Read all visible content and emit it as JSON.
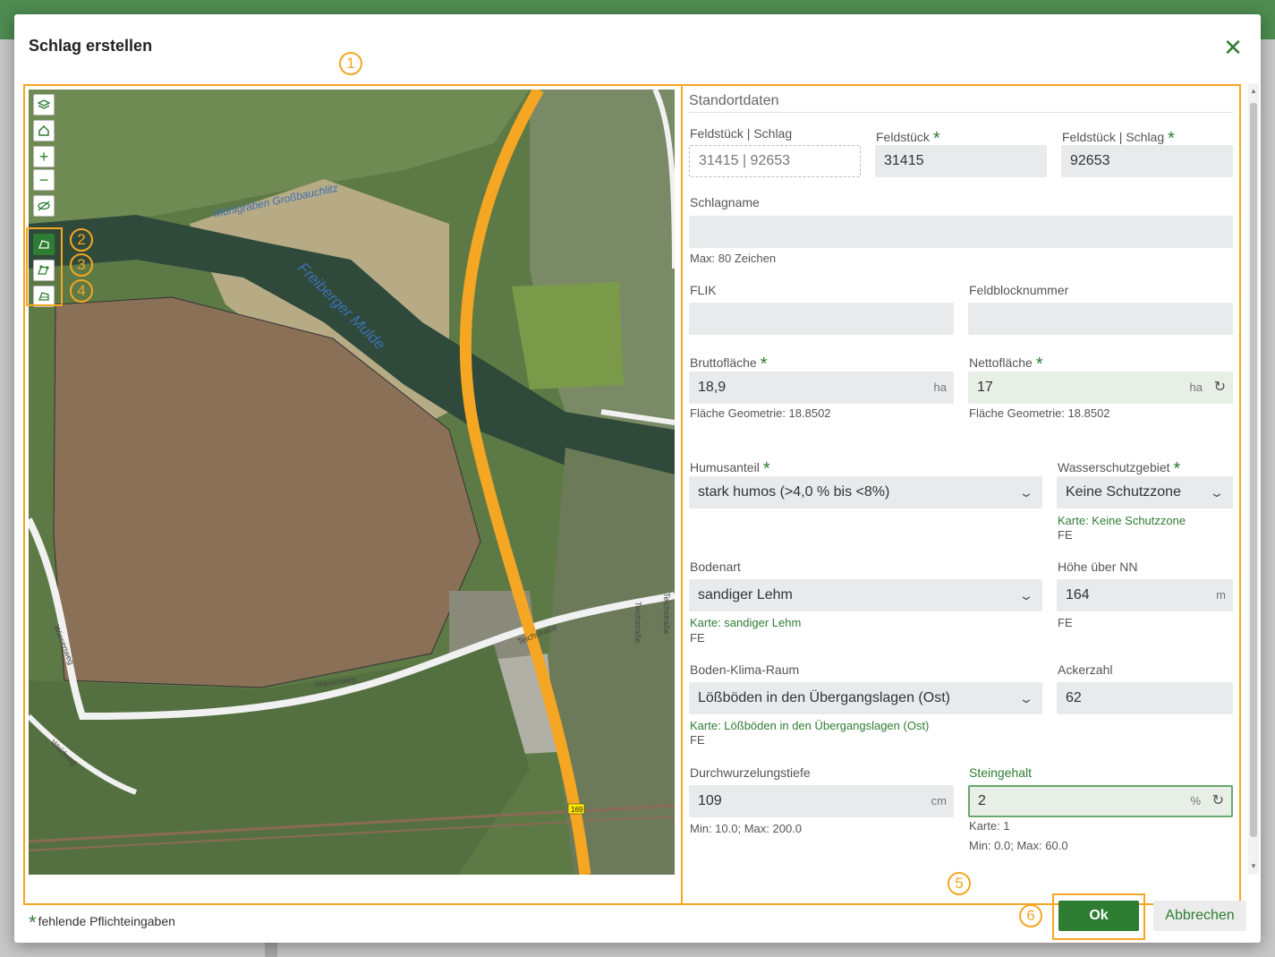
{
  "dialog": {
    "title": "Schlag erstellen",
    "close_icon": "close-icon"
  },
  "markers": [
    "1",
    "2",
    "3",
    "4",
    "5",
    "6"
  ],
  "map": {
    "labels": {
      "river": "Freiberger Mulde",
      "canal": "Mühlgraben Großbauchlitz",
      "road1": "Teichstraße",
      "road2": "Wiesenweg",
      "road3": "Wiesenweg",
      "road4": "Waldweg",
      "road5": "Teichstraße",
      "road6": "Teichstraße",
      "road_sign": "169"
    },
    "tools": [
      "layers-icon",
      "home-icon",
      "zoom-in-icon",
      "zoom-out-icon",
      "visibility-off-icon",
      "draw-polygon-icon",
      "edit-polygon-icon",
      "cut-polygon-icon"
    ],
    "tool_symbols": {
      "zoom_in": "+",
      "zoom_out": "−"
    }
  },
  "form": {
    "section_title": "Standortdaten",
    "feldstueck_schlag": {
      "label": "Feldstück | Schlag",
      "value": "31415 | 92653"
    },
    "feldstueck": {
      "label": "Feldstück",
      "value": "31415"
    },
    "feldstueck_schlag2": {
      "label": "Feldstück | Schlag",
      "value": "92653"
    },
    "schlagname": {
      "label": "Schlagname",
      "value": "",
      "hint": "Max: 80 Zeichen"
    },
    "flik": {
      "label": "FLIK",
      "value": ""
    },
    "feldblocknummer": {
      "label": "Feldblocknummer",
      "value": ""
    },
    "bruttoflaeche": {
      "label": "Bruttofläche",
      "value": "18,9",
      "unit": "ha",
      "hint": "Fläche Geometrie: 18.8502"
    },
    "nettoflaeche": {
      "label": "Nettofläche",
      "value": "17",
      "unit": "ha",
      "hint": "Fläche Geometrie: 18.8502"
    },
    "humusanteil": {
      "label": "Humusanteil",
      "value": "stark humos (>4,0 % bis <8%)"
    },
    "wasserschutzgebiet": {
      "label": "Wasserschutzgebiet",
      "value": "Keine Schutzzone",
      "hint_map": "Karte: Keine Schutzzone",
      "hint_src": "FE"
    },
    "bodenart": {
      "label": "Bodenart",
      "value": "sandiger Lehm",
      "hint_map": "Karte: sandiger Lehm",
      "hint_src": "FE"
    },
    "hoehe": {
      "label": "Höhe über NN",
      "value": "164",
      "unit": "m",
      "hint_src": "FE"
    },
    "boden_klima_raum": {
      "label": "Boden-Klima-Raum",
      "value": "Lößböden in den Übergangslagen (Ost)",
      "hint_map": "Karte: Lößböden in den Übergangslagen (Ost)",
      "hint_src": "FE"
    },
    "ackerzahl": {
      "label": "Ackerzahl",
      "value": "62"
    },
    "durchwurzelungstiefe": {
      "label": "Durchwurzelungstiefe",
      "value": "109",
      "unit": "cm",
      "hint": "Min: 10.0; Max: 200.0"
    },
    "steingehalt": {
      "label": "Steingehalt",
      "value": "2",
      "unit": "%",
      "hint_map": "Karte: 1",
      "hint": "Min: 0.0; Max: 60.0"
    },
    "required_mark": "*",
    "dropdown_icon": "chevron-down-icon",
    "refresh_icon": "refresh-icon",
    "refresh_symbol": "↻",
    "chevron_symbol": "⌄"
  },
  "footer": {
    "required_note_mark": "*",
    "required_note": "fehlende Pflichteingaben",
    "ok_label": "Ok",
    "cancel_label": "Abbrechen"
  },
  "colors": {
    "accent_green": "#2e7d32",
    "annotation_orange": "#f5a623",
    "header_green": "#4e8c50"
  }
}
